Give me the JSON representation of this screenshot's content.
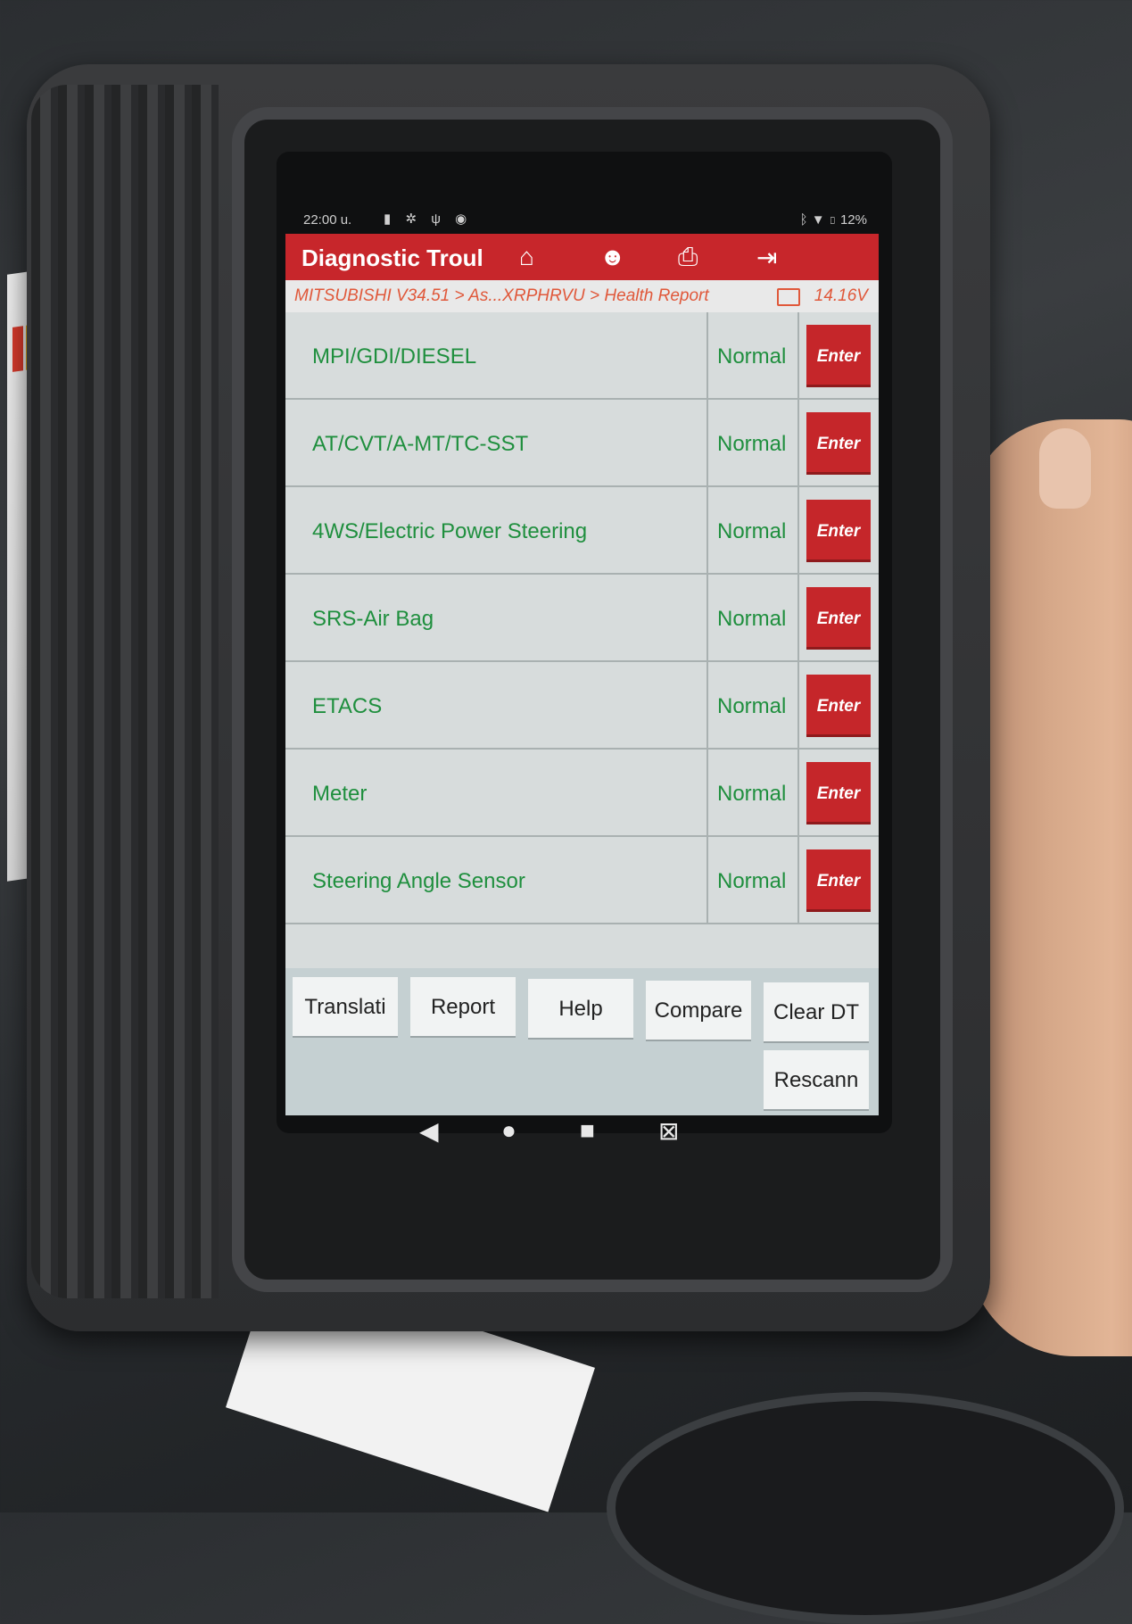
{
  "status_bar": {
    "time": "22:00",
    "time_suffix": "u.",
    "battery": "12%",
    "left_icons": [
      "battery-saver-icon",
      "settings-icon",
      "usb-icon",
      "app-icon"
    ],
    "right_icons": [
      "bluetooth-icon",
      "wifi-icon",
      "battery-icon"
    ]
  },
  "app_bar": {
    "title": "Diagnostic Troul",
    "icons": [
      "home-icon",
      "user-icon",
      "print-icon",
      "exit-icon"
    ]
  },
  "breadcrumb": {
    "path": "MITSUBISHI V34.51 > As...XRPHRVU > Health Report",
    "voltage": "14.16V"
  },
  "systems": [
    {
      "name": "MPI/GDI/DIESEL",
      "status": "Normal",
      "action": "Enter"
    },
    {
      "name": "AT/CVT/A-MT/TC-SST",
      "status": "Normal",
      "action": "Enter"
    },
    {
      "name": "4WS/Electric Power Steering",
      "status": "Normal",
      "action": "Enter"
    },
    {
      "name": "SRS-Air Bag",
      "status": "Normal",
      "action": "Enter"
    },
    {
      "name": "ETACS",
      "status": "Normal",
      "action": "Enter"
    },
    {
      "name": "Meter",
      "status": "Normal",
      "action": "Enter"
    },
    {
      "name": "Steering Angle Sensor",
      "status": "Normal",
      "action": "Enter"
    }
  ],
  "actions": {
    "translate": "Translati",
    "report": "Report",
    "help": "Help",
    "compare": "Compare",
    "clear_dtc": "Clear DT",
    "rescan": "Rescann"
  },
  "nav": [
    "back-icon",
    "home-circle-icon",
    "recents-icon",
    "screenshot-icon"
  ],
  "colors": {
    "accent_red": "#c7262b",
    "status_green": "#1f8f3e",
    "breadcrumb_orange": "#e0583a"
  }
}
